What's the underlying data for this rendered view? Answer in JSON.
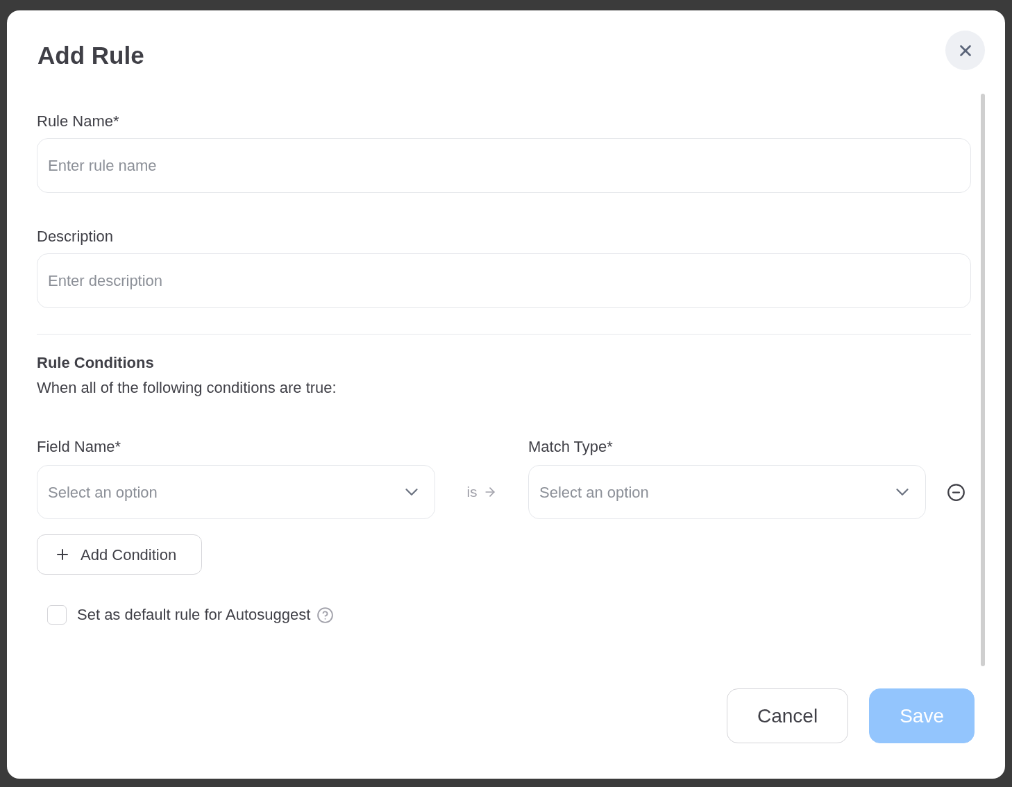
{
  "dialog": {
    "title": "Add Rule"
  },
  "fields": [
    {
      "label": "Rule Name*",
      "placeholder": "Enter rule name"
    },
    {
      "label": "Description",
      "placeholder": "Enter description"
    }
  ],
  "conditions_section": {
    "heading": "Rule Conditions",
    "subtitle": "When all of the following conditions are true:"
  },
  "condition": {
    "field": {
      "label": "Field Name*",
      "placeholder": "Select an option"
    },
    "operator": "is",
    "match": {
      "label": "Match Type*",
      "placeholder": "Select an option"
    }
  },
  "add_condition": "Add Condition",
  "default_rule": {
    "label": "Set as default rule for Autosuggest",
    "checked": false
  },
  "buttons": [
    {
      "label": "Cancel",
      "kind": "secondary",
      "disabled": false
    },
    {
      "label": "Save",
      "kind": "primary",
      "disabled": true
    }
  ]
}
